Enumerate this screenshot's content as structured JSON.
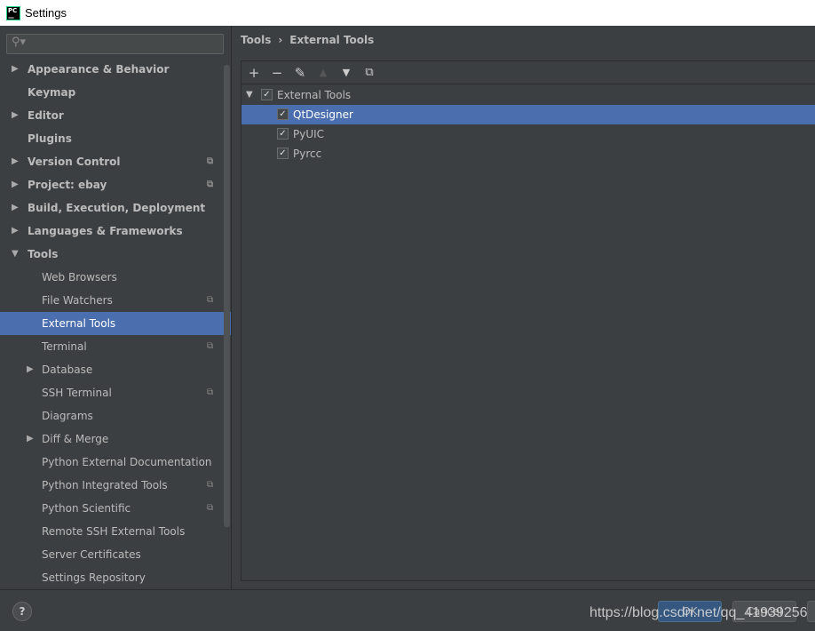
{
  "window": {
    "title": "Settings",
    "logo": "PC"
  },
  "search": {
    "icon": "search-icon",
    "placeholder": ""
  },
  "sidebar": {
    "items": [
      {
        "label": "Appearance & Behavior",
        "level": 0,
        "arrow": "right"
      },
      {
        "label": "Keymap",
        "level": 0
      },
      {
        "label": "Editor",
        "level": 0,
        "arrow": "right"
      },
      {
        "label": "Plugins",
        "level": 0
      },
      {
        "label": "Version Control",
        "level": 0,
        "arrow": "right",
        "copy": true
      },
      {
        "label": "Project: ebay",
        "level": 0,
        "arrow": "right",
        "copy": true
      },
      {
        "label": "Build, Execution, Deployment",
        "level": 0,
        "arrow": "right"
      },
      {
        "label": "Languages & Frameworks",
        "level": 0,
        "arrow": "right"
      },
      {
        "label": "Tools",
        "level": 0,
        "arrow": "down"
      },
      {
        "label": "Web Browsers",
        "level": 1
      },
      {
        "label": "File Watchers",
        "level": 1,
        "copy": true
      },
      {
        "label": "External Tools",
        "level": 1,
        "selected": true
      },
      {
        "label": "Terminal",
        "level": 1,
        "copy": true
      },
      {
        "label": "Database",
        "level": 1,
        "arrow": "right"
      },
      {
        "label": "SSH Terminal",
        "level": 1,
        "copy": true
      },
      {
        "label": "Diagrams",
        "level": 1
      },
      {
        "label": "Diff & Merge",
        "level": 1,
        "arrow": "right"
      },
      {
        "label": "Python External Documentation",
        "level": 1
      },
      {
        "label": "Python Integrated Tools",
        "level": 1,
        "copy": true
      },
      {
        "label": "Python Scientific",
        "level": 1,
        "copy": true
      },
      {
        "label": "Remote SSH External Tools",
        "level": 1
      },
      {
        "label": "Server Certificates",
        "level": 1
      },
      {
        "label": "Settings Repository",
        "level": 1
      }
    ]
  },
  "breadcrumb": {
    "parent": "Tools",
    "sep": "›",
    "current": "External Tools"
  },
  "toolbar": [
    "plus-icon",
    "minus-icon",
    "edit-icon",
    "move-up-icon",
    "move-down-icon",
    "copy-icon"
  ],
  "tree": {
    "group": "External Tools",
    "items": [
      {
        "label": "QtDesigner",
        "checked": true,
        "selected": true
      },
      {
        "label": "PyUIC",
        "checked": true
      },
      {
        "label": "Pyrcc",
        "checked": true
      }
    ]
  },
  "buttons": {
    "help": "?",
    "ok": "OK",
    "cancel": "Cancel"
  },
  "watermark": "https://blog.csdn.net/qq_41939256",
  "colors": {
    "selection": "#4b6eaf",
    "background": "#3c3f41"
  }
}
